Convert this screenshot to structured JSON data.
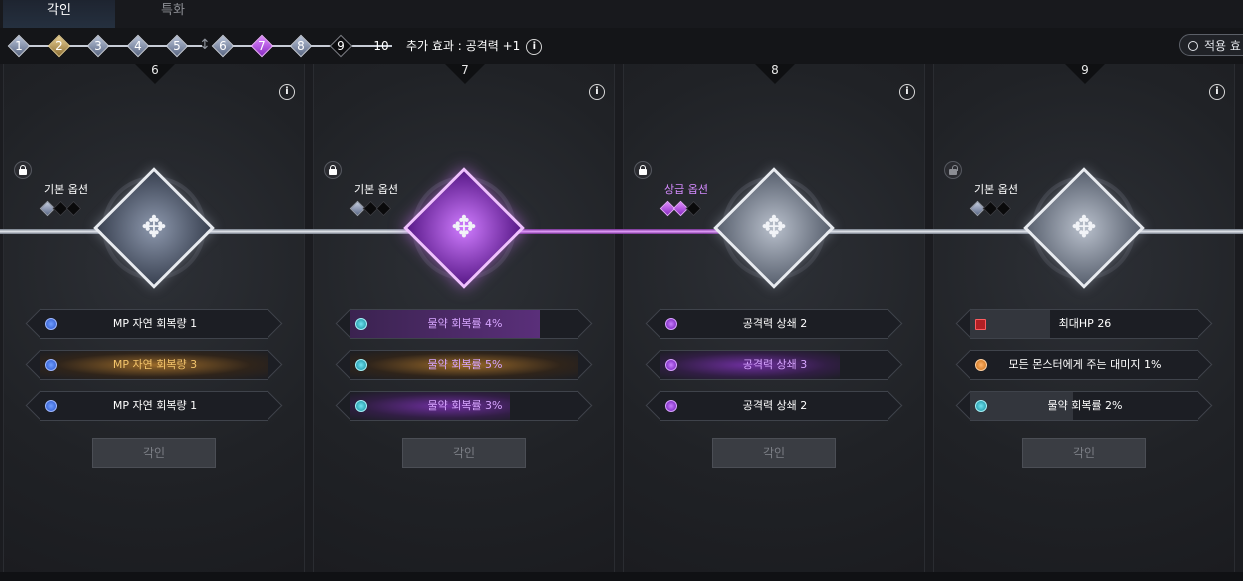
{
  "tabs": [
    {
      "label": "각인"
    },
    {
      "label": "특화"
    }
  ],
  "progress": {
    "steps": [
      {
        "label": "1",
        "style": "base"
      },
      {
        "label": "2",
        "style": "gold"
      },
      {
        "label": "3",
        "style": "base"
      },
      {
        "label": "4",
        "style": "base"
      },
      {
        "label": "5",
        "style": "base"
      },
      {
        "label": "6",
        "style": "base"
      },
      {
        "label": "7",
        "style": "purple"
      },
      {
        "label": "8",
        "style": "base"
      },
      {
        "label": "9",
        "style": "dark"
      },
      {
        "label": "10",
        "style": "plain"
      }
    ],
    "bonus_text": "추가 효과 : 공격력 +1",
    "info_glyph": "i"
  },
  "applied_button": {
    "label": "적용 효"
  },
  "panels": [
    {
      "number": "6",
      "info_glyph": "i",
      "locked": true,
      "option_label": "기본 옵션",
      "option_tier": "base",
      "option_gems": [
        "on",
        "off",
        "off"
      ],
      "emblem_style": "base",
      "emblem_glyph": "✥",
      "slots": [
        {
          "text": "MP 자연 회복량 1",
          "gem": "blue",
          "text_style": "normal",
          "fill_color": "",
          "fill": 0
        },
        {
          "text": "MP 자연 회복량 3",
          "gem": "blue",
          "text_style": "gold",
          "fill_color": "#8a5a22",
          "fill": 1
        },
        {
          "text": "MP 자연 회복량 1",
          "gem": "blue",
          "text_style": "normal",
          "fill_color": "",
          "fill": 0
        }
      ],
      "button_label": "각인"
    },
    {
      "number": "7",
      "info_glyph": "i",
      "locked": true,
      "option_label": "기본 옵션",
      "option_tier": "base",
      "option_gems": [
        "on",
        "off",
        "off"
      ],
      "emblem_style": "purple",
      "emblem_glyph": "✥",
      "slots": [
        {
          "text": "물약 회복률 4%",
          "gem": "cyan",
          "text_style": "lavender",
          "fill_color": "#4a2a63",
          "fill": 0.85
        },
        {
          "text": "물약 회복률 5%",
          "gem": "cyan",
          "text_style": "lavender",
          "fill_color": "#8a5a22",
          "fill": 1
        },
        {
          "text": "물약 회복률 3%",
          "gem": "cyan",
          "text_style": "lavender",
          "fill_color": "#5a2a7a",
          "fill": 0.7
        }
      ],
      "button_label": "각인"
    },
    {
      "number": "8",
      "info_glyph": "i",
      "locked": true,
      "option_label": "상급 옵션",
      "option_tier": "upper",
      "option_gems": [
        "onp",
        "onp",
        "off"
      ],
      "emblem_style": "light",
      "emblem_glyph": "✥",
      "slots": [
        {
          "text": "공격력 상쇄 2",
          "gem": "purple",
          "text_style": "normal",
          "fill_color": "",
          "fill": 0
        },
        {
          "text": "공격력 상쇄 3",
          "gem": "purple",
          "text_style": "lavender",
          "fill_color": "#5a2a7a",
          "fill": 0.8
        },
        {
          "text": "공격력 상쇄 2",
          "gem": "purple",
          "text_style": "normal",
          "fill_color": "",
          "fill": 0
        }
      ],
      "button_label": "각인"
    },
    {
      "number": "9",
      "info_glyph": "i",
      "locked": false,
      "option_label": "기본 옵션",
      "option_tier": "base",
      "option_gems": [
        "on",
        "off",
        "off"
      ],
      "emblem_style": "light",
      "emblem_glyph": "✥",
      "slots": [
        {
          "text": "최대HP 26",
          "gem": "red",
          "text_style": "normal",
          "fill_color": "#33363d",
          "fill": 0.35
        },
        {
          "text": "모든 몬스터에게 주는 대미지 1%",
          "gem": "orange",
          "text_style": "normal",
          "fill_color": "",
          "fill": 0
        },
        {
          "text": "물약 회복률 2%",
          "gem": "cyan",
          "text_style": "normal",
          "fill_color": "#33363d",
          "fill": 0.45
        }
      ],
      "button_label": "각인"
    }
  ],
  "colors": {
    "accent_purple": "#c15cff",
    "gold": "#f3c46b",
    "background": "#1b1c20"
  }
}
